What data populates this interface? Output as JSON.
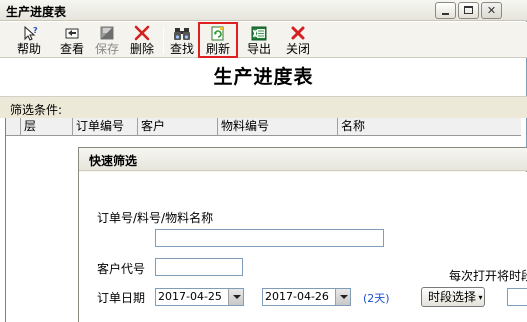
{
  "window": {
    "title": "生产进度表"
  },
  "toolbar": {
    "help": "帮助",
    "view": "查看",
    "save": "保存",
    "delete": "删除",
    "find": "查找",
    "refresh": "刷新",
    "export": "导出",
    "close": "关闭"
  },
  "report": {
    "title": "生产进度表"
  },
  "filter": {
    "label": "筛选条件:"
  },
  "grid": {
    "columns": [
      "层",
      "订单编号",
      "客户",
      "物料编号",
      "名称"
    ]
  },
  "dialog": {
    "title": "快速筛选",
    "order_label": "订单号/料号/物料名称",
    "order_value": "",
    "customer_label": "客户代号",
    "customer_value": "",
    "hint": "每次打开将时段",
    "date_label": "订单日期",
    "date_from": "2017-04-25",
    "date_to": "2017-04-26",
    "days": "(2天)",
    "period_button": "时段选择"
  },
  "colors": {
    "highlight": "#e02020",
    "delete_x": "#d42020",
    "close_x": "#d42020",
    "link": "#1a4fd0"
  }
}
